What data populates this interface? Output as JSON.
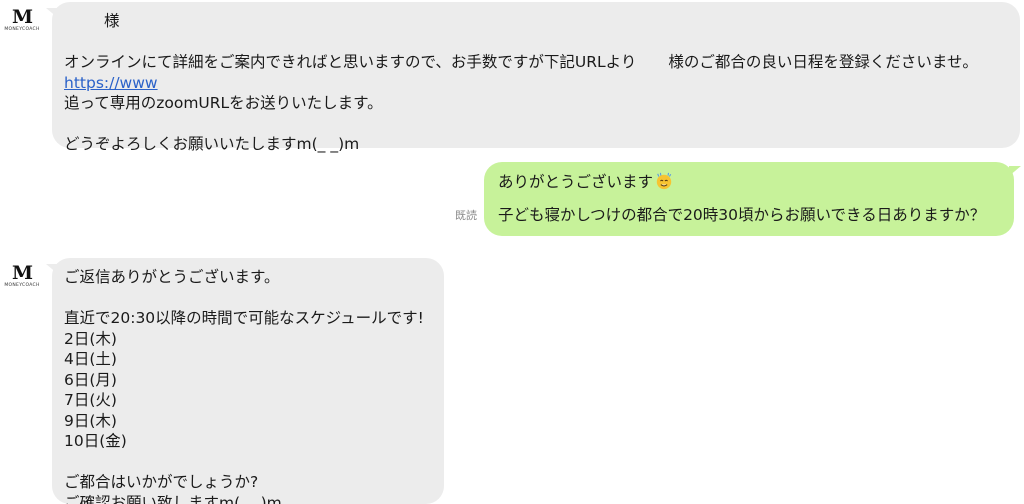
{
  "avatar": {
    "initial": "M",
    "brand": "MONEYCOACH"
  },
  "messages": {
    "m1": {
      "salutation": "様",
      "line1a": "オンラインにて詳細をご案内できればと思いますので、お手数ですが下記URLより",
      "line1b": "様のご都合の良い日程を登録くださいませ。",
      "link": "https://www",
      "line2": "追って専用のzoomURLをお送りいたします。",
      "line3": "どうぞよろしくお願いいたしますm(_ _)m"
    },
    "m2": {
      "line1": "ありがとうございます",
      "line2": "子ども寝かしつけの都合で20時30頃からお願いできる日ありますか？",
      "read_label": "既読",
      "emoji": "sweating-face-emoji"
    },
    "m3": {
      "line1": "ご返信ありがとうございます。",
      "line2": "直近で20:30以降の時間で可能なスケジュールです!",
      "dates": [
        "2日(木)",
        "4日(土)",
        "6日(月)",
        "7日(火)",
        "9日(木)",
        "10日(金)"
      ],
      "line3": "ご都合はいかがでしょうか?",
      "line4": "ご確認お願い致しますm(_ _)m"
    }
  },
  "colors": {
    "incoming_bubble": "#ececec",
    "outgoing_bubble": "#c7f29a",
    "link": "#2b62c9",
    "read_label": "#8a8a8a"
  }
}
